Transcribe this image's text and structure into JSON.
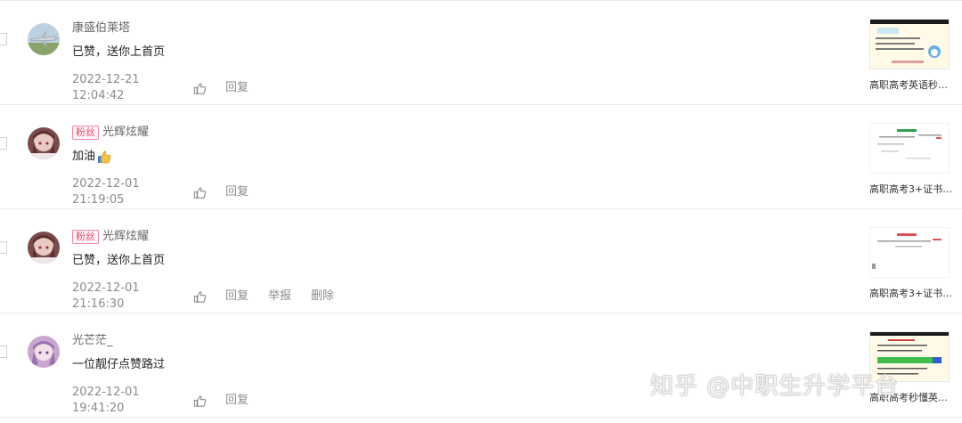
{
  "comments": [
    {
      "username": "康盛伯莱塔",
      "fan_badge": "",
      "text": "已赞，送你上首页",
      "emoji": "",
      "date": "2022-12-21 12:04:42",
      "actions": [
        "回复"
      ],
      "article_title": "高职高考英语秒…",
      "avatar": "plane-avatar"
    },
    {
      "username": "光辉炫耀",
      "fan_badge": "粉丝",
      "text": "加油",
      "emoji": "thumbs-up-emoji",
      "date": "2022-12-01 21:19:05",
      "actions": [
        "回复"
      ],
      "article_title": "高职高考3+证书…",
      "avatar": "anime-girl-avatar"
    },
    {
      "username": "光辉炫耀",
      "fan_badge": "粉丝",
      "text": "已赞，送你上首页",
      "emoji": "",
      "date": "2022-12-01 21:16:30",
      "actions": [
        "回复",
        "举报",
        "删除"
      ],
      "article_title": "高职高考3+证书…",
      "avatar": "anime-girl-avatar"
    },
    {
      "username": "光芒茫_",
      "fan_badge": "",
      "text": "一位靓仔点赞路过",
      "emoji": "",
      "date": "2022-12-01 19:41:20",
      "actions": [
        "回复"
      ],
      "article_title": "高职高考秒懂英…",
      "avatar": "purple-girl-avatar"
    }
  ],
  "watermark": "知乎 @中职生升学平台",
  "colors": {
    "fan_badge": "#e64a70",
    "muted": "#8c8c8c",
    "divider": "#ebebeb"
  }
}
